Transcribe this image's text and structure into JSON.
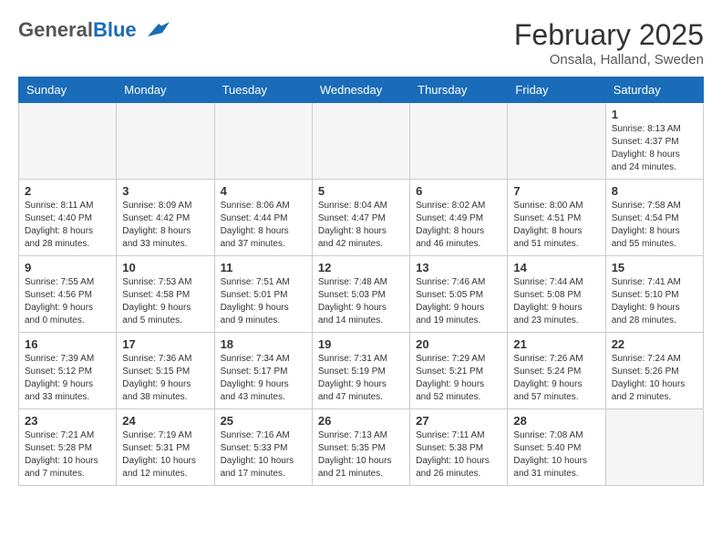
{
  "header": {
    "logo_general": "General",
    "logo_blue": "Blue",
    "month_title": "February 2025",
    "location": "Onsala, Halland, Sweden"
  },
  "weekdays": [
    "Sunday",
    "Monday",
    "Tuesday",
    "Wednesday",
    "Thursday",
    "Friday",
    "Saturday"
  ],
  "weeks": [
    [
      {
        "day": "",
        "info": ""
      },
      {
        "day": "",
        "info": ""
      },
      {
        "day": "",
        "info": ""
      },
      {
        "day": "",
        "info": ""
      },
      {
        "day": "",
        "info": ""
      },
      {
        "day": "",
        "info": ""
      },
      {
        "day": "1",
        "info": "Sunrise: 8:13 AM\nSunset: 4:37 PM\nDaylight: 8 hours and 24 minutes."
      }
    ],
    [
      {
        "day": "2",
        "info": "Sunrise: 8:11 AM\nSunset: 4:40 PM\nDaylight: 8 hours and 28 minutes."
      },
      {
        "day": "3",
        "info": "Sunrise: 8:09 AM\nSunset: 4:42 PM\nDaylight: 8 hours and 33 minutes."
      },
      {
        "day": "4",
        "info": "Sunrise: 8:06 AM\nSunset: 4:44 PM\nDaylight: 8 hours and 37 minutes."
      },
      {
        "day": "5",
        "info": "Sunrise: 8:04 AM\nSunset: 4:47 PM\nDaylight: 8 hours and 42 minutes."
      },
      {
        "day": "6",
        "info": "Sunrise: 8:02 AM\nSunset: 4:49 PM\nDaylight: 8 hours and 46 minutes."
      },
      {
        "day": "7",
        "info": "Sunrise: 8:00 AM\nSunset: 4:51 PM\nDaylight: 8 hours and 51 minutes."
      },
      {
        "day": "8",
        "info": "Sunrise: 7:58 AM\nSunset: 4:54 PM\nDaylight: 8 hours and 55 minutes."
      }
    ],
    [
      {
        "day": "9",
        "info": "Sunrise: 7:55 AM\nSunset: 4:56 PM\nDaylight: 9 hours and 0 minutes."
      },
      {
        "day": "10",
        "info": "Sunrise: 7:53 AM\nSunset: 4:58 PM\nDaylight: 9 hours and 5 minutes."
      },
      {
        "day": "11",
        "info": "Sunrise: 7:51 AM\nSunset: 5:01 PM\nDaylight: 9 hours and 9 minutes."
      },
      {
        "day": "12",
        "info": "Sunrise: 7:48 AM\nSunset: 5:03 PM\nDaylight: 9 hours and 14 minutes."
      },
      {
        "day": "13",
        "info": "Sunrise: 7:46 AM\nSunset: 5:05 PM\nDaylight: 9 hours and 19 minutes."
      },
      {
        "day": "14",
        "info": "Sunrise: 7:44 AM\nSunset: 5:08 PM\nDaylight: 9 hours and 23 minutes."
      },
      {
        "day": "15",
        "info": "Sunrise: 7:41 AM\nSunset: 5:10 PM\nDaylight: 9 hours and 28 minutes."
      }
    ],
    [
      {
        "day": "16",
        "info": "Sunrise: 7:39 AM\nSunset: 5:12 PM\nDaylight: 9 hours and 33 minutes."
      },
      {
        "day": "17",
        "info": "Sunrise: 7:36 AM\nSunset: 5:15 PM\nDaylight: 9 hours and 38 minutes."
      },
      {
        "day": "18",
        "info": "Sunrise: 7:34 AM\nSunset: 5:17 PM\nDaylight: 9 hours and 43 minutes."
      },
      {
        "day": "19",
        "info": "Sunrise: 7:31 AM\nSunset: 5:19 PM\nDaylight: 9 hours and 47 minutes."
      },
      {
        "day": "20",
        "info": "Sunrise: 7:29 AM\nSunset: 5:21 PM\nDaylight: 9 hours and 52 minutes."
      },
      {
        "day": "21",
        "info": "Sunrise: 7:26 AM\nSunset: 5:24 PM\nDaylight: 9 hours and 57 minutes."
      },
      {
        "day": "22",
        "info": "Sunrise: 7:24 AM\nSunset: 5:26 PM\nDaylight: 10 hours and 2 minutes."
      }
    ],
    [
      {
        "day": "23",
        "info": "Sunrise: 7:21 AM\nSunset: 5:28 PM\nDaylight: 10 hours and 7 minutes."
      },
      {
        "day": "24",
        "info": "Sunrise: 7:19 AM\nSunset: 5:31 PM\nDaylight: 10 hours and 12 minutes."
      },
      {
        "day": "25",
        "info": "Sunrise: 7:16 AM\nSunset: 5:33 PM\nDaylight: 10 hours and 17 minutes."
      },
      {
        "day": "26",
        "info": "Sunrise: 7:13 AM\nSunset: 5:35 PM\nDaylight: 10 hours and 21 minutes."
      },
      {
        "day": "27",
        "info": "Sunrise: 7:11 AM\nSunset: 5:38 PM\nDaylight: 10 hours and 26 minutes."
      },
      {
        "day": "28",
        "info": "Sunrise: 7:08 AM\nSunset: 5:40 PM\nDaylight: 10 hours and 31 minutes."
      },
      {
        "day": "",
        "info": ""
      }
    ]
  ]
}
